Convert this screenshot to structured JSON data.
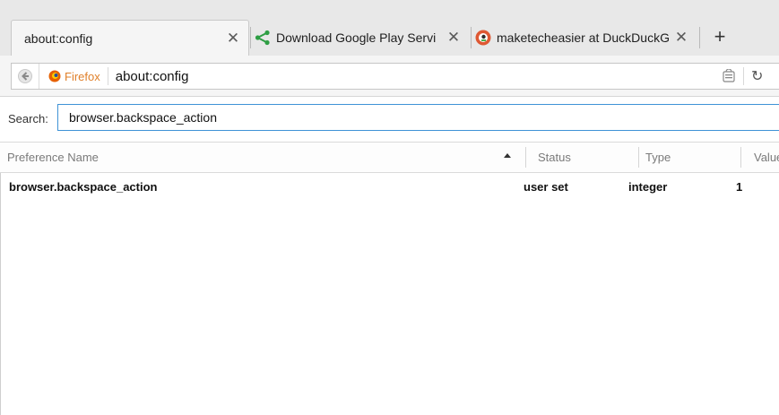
{
  "tabs": [
    {
      "title": "about:config",
      "active": true,
      "favicon": "none"
    },
    {
      "title": "Download Google Play Servi",
      "active": false,
      "favicon": "share-icon"
    },
    {
      "title": "maketecheasier at DuckDuckG",
      "active": false,
      "favicon": "duckduckgo-icon"
    }
  ],
  "new_tab_symbol": "+",
  "close_symbol": "✕",
  "navbar": {
    "identity_label": "Firefox",
    "url": "about:config",
    "reload_symbol": "↻"
  },
  "search": {
    "label": "Search:",
    "value": "browser.backspace_action"
  },
  "table": {
    "columns": [
      "Preference Name",
      "Status",
      "Type",
      "Value"
    ],
    "rows": [
      {
        "name": "browser.backspace_action",
        "status": "user set",
        "type": "integer",
        "value": "1"
      }
    ]
  },
  "colors": {
    "share_icon": "#2e9e44",
    "duckduckgo_icon": "#de5833",
    "firefox_icon": "#e66000",
    "search_focus_border": "#3f93d6"
  }
}
